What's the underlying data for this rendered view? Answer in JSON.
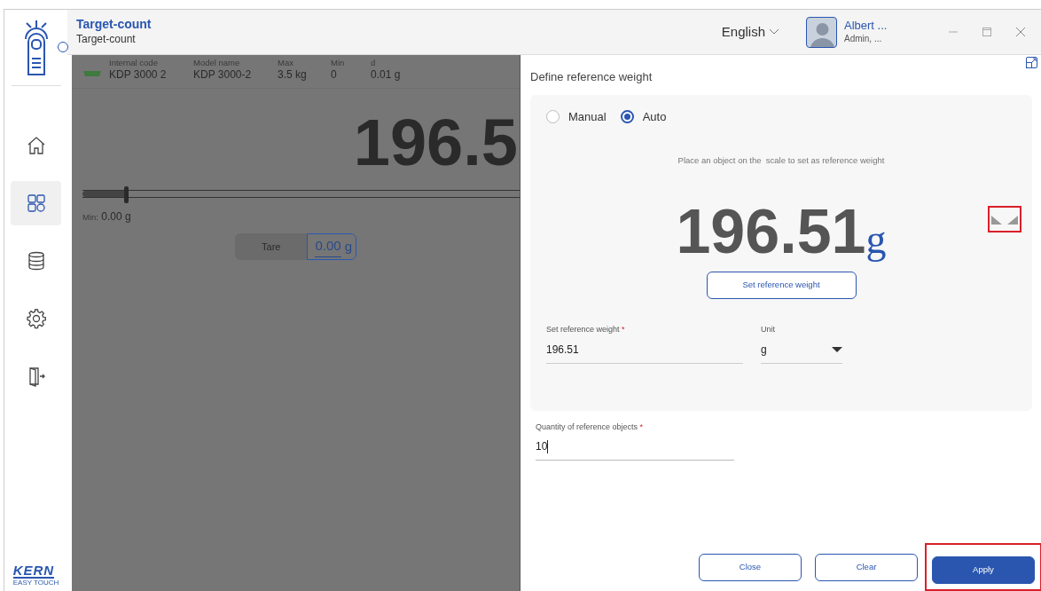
{
  "header": {
    "title": "Target-count",
    "subtitle": "Target-count",
    "language": "English",
    "user": {
      "name": "Albert ...",
      "role": "Admin, ..."
    }
  },
  "sidebar": {
    "items": [
      {
        "kind": "home",
        "selected": false
      },
      {
        "kind": "apps",
        "selected": true
      },
      {
        "kind": "database",
        "selected": false
      },
      {
        "kind": "settings",
        "selected": false
      },
      {
        "kind": "logout",
        "selected": false
      }
    ],
    "logo": {
      "brand": "KERN",
      "tagline": "EASY TOUCH"
    }
  },
  "device_info": [
    {
      "label": "Internal code",
      "value": "KDP 3000 2"
    },
    {
      "label": "Model name",
      "value": "KDP 3000-2"
    },
    {
      "label": "Max",
      "value": "3.5 kg"
    },
    {
      "label": "Min",
      "value": "0"
    },
    {
      "label": "d",
      "value": "0.01 g"
    }
  ],
  "background": {
    "weight": "196.5",
    "level": 0.1,
    "min_label": "Min:",
    "min_value": "0.00 g",
    "tare": {
      "label": "Tare",
      "value": "0.00",
      "unit": "g"
    }
  },
  "dialog": {
    "title": "Define reference weight",
    "modes": [
      {
        "label": "Manual",
        "selected": false
      },
      {
        "label": "Auto",
        "selected": true
      }
    ],
    "hint": "Place an object on the  scale to set as reference weight",
    "weight": "196.51",
    "unit": "g",
    "stability_highlighted": true,
    "set_button": "Set reference weight",
    "fields": [
      {
        "kind": "text",
        "label": "Set reference weight",
        "required_mark": "*",
        "value": "196.51"
      },
      {
        "kind": "select",
        "label": "Unit",
        "value": "g"
      }
    ],
    "quantity": {
      "label": "Quantity of reference objects",
      "required_mark": "*",
      "value": "10"
    },
    "buttons": [
      {
        "label": "Close",
        "kind": "outline",
        "highlighted": false
      },
      {
        "label": "Clear",
        "kind": "outline",
        "highlighted": false
      },
      {
        "label": "Apply",
        "kind": "primary",
        "highlighted": true
      }
    ]
  }
}
